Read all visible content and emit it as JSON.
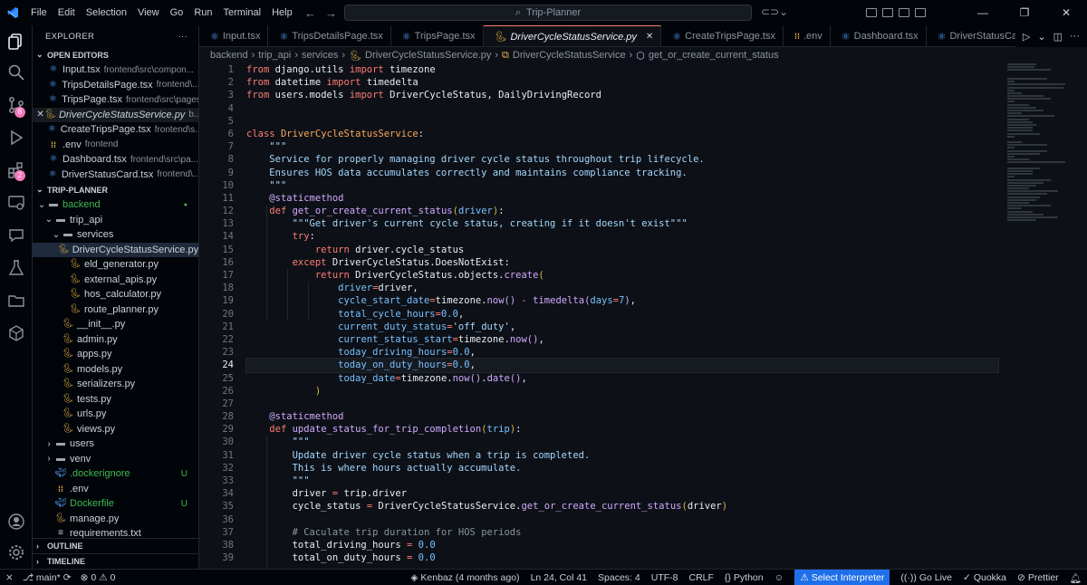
{
  "titlebar": {
    "menu": [
      "File",
      "Edit",
      "Selection",
      "View",
      "Go",
      "Run",
      "Terminal",
      "Help"
    ],
    "search": "Trip-Planner"
  },
  "activity": {
    "scm_badge": "8",
    "ext_badge": "2"
  },
  "sidebar": {
    "title": "EXPLORER",
    "more": "···",
    "open_editors_label": "OPEN EDITORS",
    "open_editors": [
      {
        "name": "Input.tsx",
        "desc": "frontend\\src\\compon...",
        "icon": "react-icon"
      },
      {
        "name": "TripsDetailsPage.tsx",
        "desc": "frontend\\...",
        "icon": "react-icon"
      },
      {
        "name": "TripsPage.tsx",
        "desc": "frontend\\src\\pages",
        "icon": "react-icon"
      },
      {
        "name": "DriverCycleStatusService.py",
        "desc": "b...",
        "icon": "python-icon",
        "active": true
      },
      {
        "name": "CreateTripsPage.tsx",
        "desc": "frontend\\s...",
        "icon": "react-icon"
      },
      {
        "name": ".env",
        "desc": "frontend",
        "icon": "env-icon"
      },
      {
        "name": "Dashboard.tsx",
        "desc": "frontend\\src\\pa...",
        "icon": "react-icon"
      },
      {
        "name": "DriverStatusCard.tsx",
        "desc": "frontend\\...",
        "icon": "react-icon"
      }
    ],
    "project_label": "TRIP-PLANNER",
    "tree": [
      {
        "name": "backend",
        "indent": 0,
        "type": "folder-open",
        "green": true,
        "dot": true
      },
      {
        "name": "trip_api",
        "indent": 1,
        "type": "folder-open"
      },
      {
        "name": "services",
        "indent": 2,
        "type": "folder-open"
      },
      {
        "name": "DriverCycleStatusService.py",
        "indent": 3,
        "type": "py",
        "selected": true
      },
      {
        "name": "eld_generator.py",
        "indent": 3,
        "type": "py"
      },
      {
        "name": "external_apis.py",
        "indent": 3,
        "type": "py"
      },
      {
        "name": "hos_calculator.py",
        "indent": 3,
        "type": "py"
      },
      {
        "name": "route_planner.py",
        "indent": 3,
        "type": "py"
      },
      {
        "name": "__init__.py",
        "indent": 2,
        "type": "py"
      },
      {
        "name": "admin.py",
        "indent": 2,
        "type": "py"
      },
      {
        "name": "apps.py",
        "indent": 2,
        "type": "py"
      },
      {
        "name": "models.py",
        "indent": 2,
        "type": "py"
      },
      {
        "name": "serializers.py",
        "indent": 2,
        "type": "py"
      },
      {
        "name": "tests.py",
        "indent": 2,
        "type": "py"
      },
      {
        "name": "urls.py",
        "indent": 2,
        "type": "py"
      },
      {
        "name": "views.py",
        "indent": 2,
        "type": "py"
      },
      {
        "name": "users",
        "indent": 1,
        "type": "folder"
      },
      {
        "name": "venv",
        "indent": 1,
        "type": "folder"
      },
      {
        "name": ".dockerignore",
        "indent": 1,
        "type": "docker",
        "green": true,
        "status": "U"
      },
      {
        "name": ".env",
        "indent": 1,
        "type": "env"
      },
      {
        "name": "Dockerfile",
        "indent": 1,
        "type": "docker",
        "green": true,
        "status": "U"
      },
      {
        "name": "manage.py",
        "indent": 1,
        "type": "py"
      },
      {
        "name": "requirements.txt",
        "indent": 1,
        "type": "txt"
      }
    ],
    "outline_label": "OUTLINE",
    "timeline_label": "TIMELINE"
  },
  "tabs": [
    {
      "name": "Input.tsx",
      "icon": "react-icon"
    },
    {
      "name": "TripsDetailsPage.tsx",
      "icon": "react-icon"
    },
    {
      "name": "TripsPage.tsx",
      "icon": "react-icon"
    },
    {
      "name": "DriverCycleStatusService.py",
      "icon": "python-icon",
      "active": true
    },
    {
      "name": "CreateTripsPage.tsx",
      "icon": "react-icon"
    },
    {
      "name": ".env",
      "icon": "env-icon"
    },
    {
      "name": "Dashboard.tsx",
      "icon": "react-icon"
    },
    {
      "name": "DriverStatusCard",
      "icon": "react-icon"
    }
  ],
  "breadcrumb": [
    "backend",
    "trip_api",
    "services",
    "DriverCycleStatusService.py",
    "DriverCycleStatusService",
    "get_or_create_current_status"
  ],
  "editor": {
    "current_line": 24,
    "start_line": 1
  },
  "statusbar": {
    "branch": "main*",
    "errors": "0",
    "warnings": "0",
    "blame": "Kenbaz (4 months ago)",
    "position": "Ln 24, Col 41",
    "spaces": "Spaces: 4",
    "encoding": "UTF-8",
    "eol": "CRLF",
    "language": "Python",
    "interpreter": "Select Interpreter",
    "golive": "Go Live",
    "quokka": "Quokka",
    "prettier": "Prettier"
  }
}
